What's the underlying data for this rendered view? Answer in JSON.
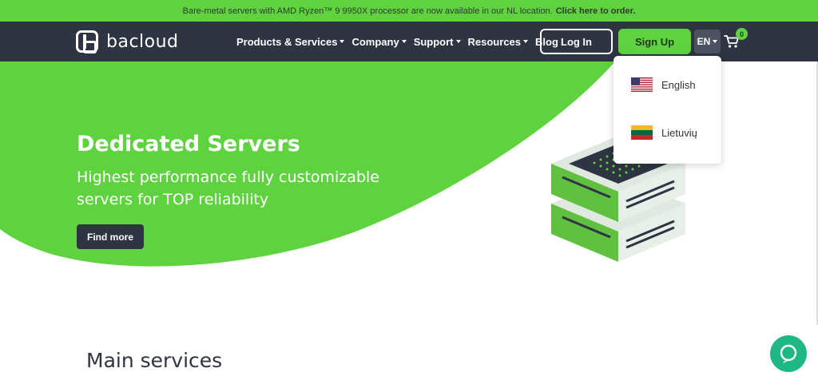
{
  "announcement": {
    "text": "Bare-metal servers with AMD Ryzen™ 9 9950X processor are now available in our NL location.",
    "link": "Click here to order."
  },
  "brand": {
    "name": "bacloud"
  },
  "nav": {
    "items": [
      {
        "label": "Products & Services",
        "dropdown": true
      },
      {
        "label": "Company",
        "dropdown": true
      },
      {
        "label": "Support",
        "dropdown": true
      },
      {
        "label": "Resources",
        "dropdown": true
      },
      {
        "label": "Blog",
        "dropdown": false
      }
    ],
    "login": "Log In",
    "signup": "Sign Up",
    "language": "EN",
    "cart_count": "0"
  },
  "language_menu": {
    "options": [
      {
        "label": "English",
        "flag": "us-flag-icon"
      },
      {
        "label": "Lietuvių",
        "flag": "lithuania-flag-icon"
      }
    ]
  },
  "hero": {
    "title": "Dedicated Servers",
    "subtitle": "Highest performance fully customizable servers for TOP reliability",
    "cta": "Find more"
  },
  "sections": {
    "main_title": "Main services"
  },
  "colors": {
    "brand_green": "#5fd33f",
    "navbar_dark": "#2f3442",
    "chat_teal": "#1fb884"
  }
}
